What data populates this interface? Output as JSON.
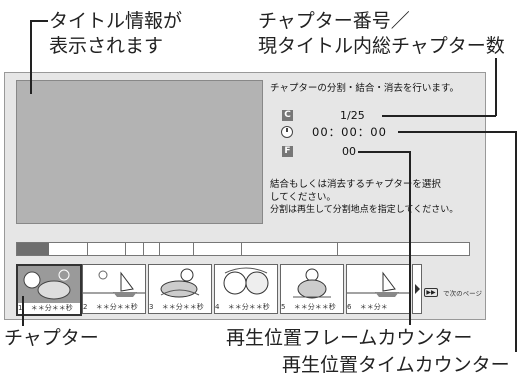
{
  "callouts": {
    "title_info": [
      "タイトル情報が",
      "表示されます"
    ],
    "chapter_number": [
      "チャプター番号／",
      "現タイトル内総チャプター数"
    ],
    "chapter": "チャプター",
    "frame_counter": "再生位置フレームカウンター",
    "time_counter": "再生位置タイムカウンター"
  },
  "screen": {
    "header": "チャプターの分割・結合・消去を行います。",
    "chapter_icon": "C",
    "chapter_value": "1/25",
    "time_value": "00：00：00",
    "frame_icon": "F",
    "frame_value": "00",
    "instructions": [
      "結合もしくは消去するチャプターを選択",
      "してください。",
      "分割は再生して分割地点を指定してください。"
    ],
    "next_page_label": "で次のページ",
    "next_page_icon": "fast-forward-icon"
  },
  "thumbnails": [
    {
      "number": "1",
      "time": "＊＊分＊＊秒",
      "selected": true
    },
    {
      "number": "2",
      "time": "＊＊分＊＊秒"
    },
    {
      "number": "3",
      "time": "＊＊分＊＊秒"
    },
    {
      "number": "4",
      "time": "＊＊分＊＊秒"
    },
    {
      "number": "5",
      "time": "＊＊分＊＊秒"
    },
    {
      "number": "6",
      "time": "＊＊分＊"
    }
  ],
  "colors": {
    "screen_bg": "#e6e6e6",
    "preview_bg": "#b3b3b3",
    "selected_segment": "#6e6e6e"
  }
}
